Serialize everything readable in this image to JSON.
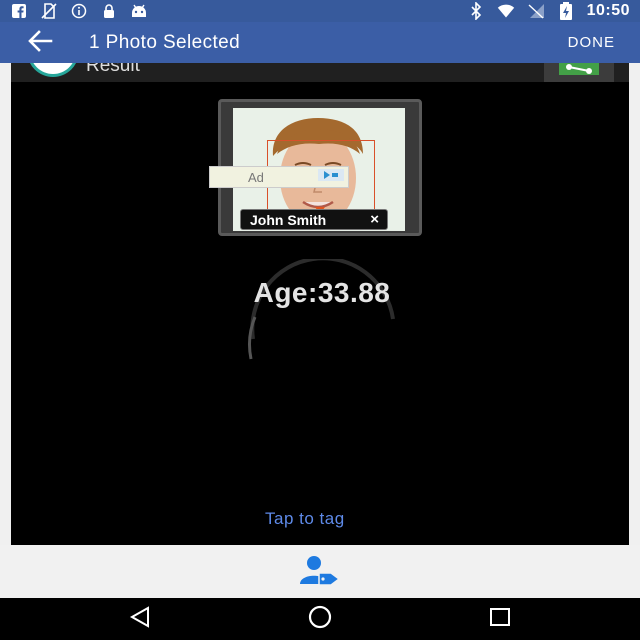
{
  "status_bar": {
    "time": "10:50",
    "left_icons": [
      "facebook-icon",
      "no-sim-icon",
      "info-icon",
      "lock-icon",
      "android-icon"
    ],
    "right_icons": [
      "bluetooth-icon",
      "wifi-icon",
      "no-signal-icon",
      "battery-charging-icon"
    ]
  },
  "app_bar": {
    "title": "1 Photo Selected",
    "done_label": "DONE",
    "back_icon": "arrow-back-icon"
  },
  "result_header": {
    "label": "Result",
    "share_icon": "share-icon"
  },
  "photo": {
    "person_name": "John Smith",
    "remove_tag_symbol": "×",
    "ad_label": "Ad"
  },
  "analysis": {
    "age_text": "Age:33.88"
  },
  "tap_to_tag": "Tap to tag",
  "bottom_action": {
    "icon": "tag-user-icon"
  },
  "navigation": {
    "back": "nav-back-icon",
    "home": "nav-home-icon",
    "recents": "nav-recents-icon"
  },
  "colors": {
    "status_bar": "#375a9c",
    "app_bar": "#3b5ea6",
    "link": "#5e8ae8",
    "accent_green": "#4caf50",
    "face_box": "#d9502a"
  }
}
